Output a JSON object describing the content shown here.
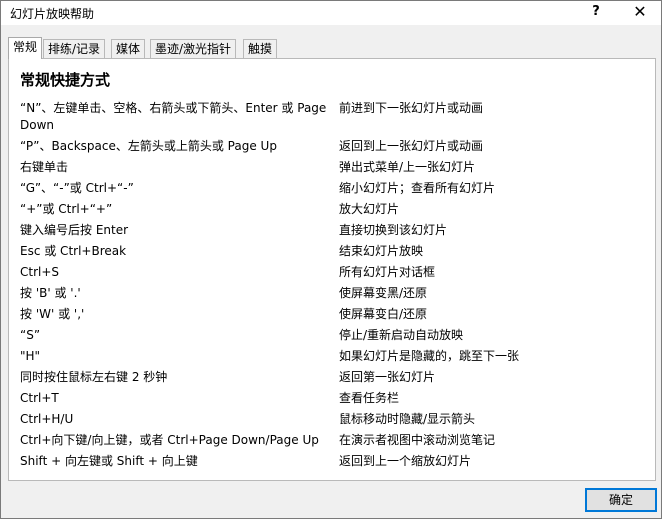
{
  "window": {
    "title": "幻灯片放映帮助",
    "help_glyph": "?",
    "close_glyph": "✕"
  },
  "tabs": [
    {
      "label": "常规"
    },
    {
      "label": "排练/记录"
    },
    {
      "label": "媒体"
    },
    {
      "label": "墨迹/激光指针"
    },
    {
      "label": "触摸"
    }
  ],
  "panel": {
    "title": "常规快捷方式",
    "shortcuts": [
      {
        "key": "“N”、左键单击、空格、右箭头或下箭头、Enter 或 Page Down",
        "action": "前进到下一张幻灯片或动画"
      },
      {
        "key": "“P”、Backspace、左箭头或上箭头或 Page Up",
        "action": "返回到上一张幻灯片或动画"
      },
      {
        "key": "右键单击",
        "action": "弹出式菜单/上一张幻灯片"
      },
      {
        "key": "“G”、“-”或 Ctrl+“-”",
        "action": "缩小幻灯片；查看所有幻灯片"
      },
      {
        "key": "“+”或 Ctrl+“+”",
        "action": "放大幻灯片"
      },
      {
        "key": "键入编号后按 Enter",
        "action": "直接切换到该幻灯片"
      },
      {
        "key": "Esc 或 Ctrl+Break",
        "action": "结束幻灯片放映"
      },
      {
        "key": "Ctrl+S",
        "action": "所有幻灯片对话框"
      },
      {
        "key": "按 'B' 或 '.'",
        "action": "使屏幕变黑/还原"
      },
      {
        "key": "按 'W' 或 ','",
        "action": "使屏幕变白/还原"
      },
      {
        "key": "“S”",
        "action": "停止/重新启动自动放映"
      },
      {
        "key": "\"H\"",
        "action": "如果幻灯片是隐藏的，跳至下一张"
      },
      {
        "key": "同时按住鼠标左右键 2 秒钟",
        "action": "返回第一张幻灯片"
      },
      {
        "key": "Ctrl+T",
        "action": "查看任务栏"
      },
      {
        "key": "Ctrl+H/U",
        "action": "鼠标移动时隐藏/显示箭头"
      },
      {
        "key": "Ctrl+向下键/向上键，或者 Ctrl+Page Down/Page Up",
        "action": "在演示者视图中滚动浏览笔记"
      },
      {
        "key": "Shift + 向左键或 Shift + 向上键",
        "action": "返回到上一个缩放幻灯片"
      }
    ]
  },
  "footer": {
    "ok_label": "确定"
  }
}
